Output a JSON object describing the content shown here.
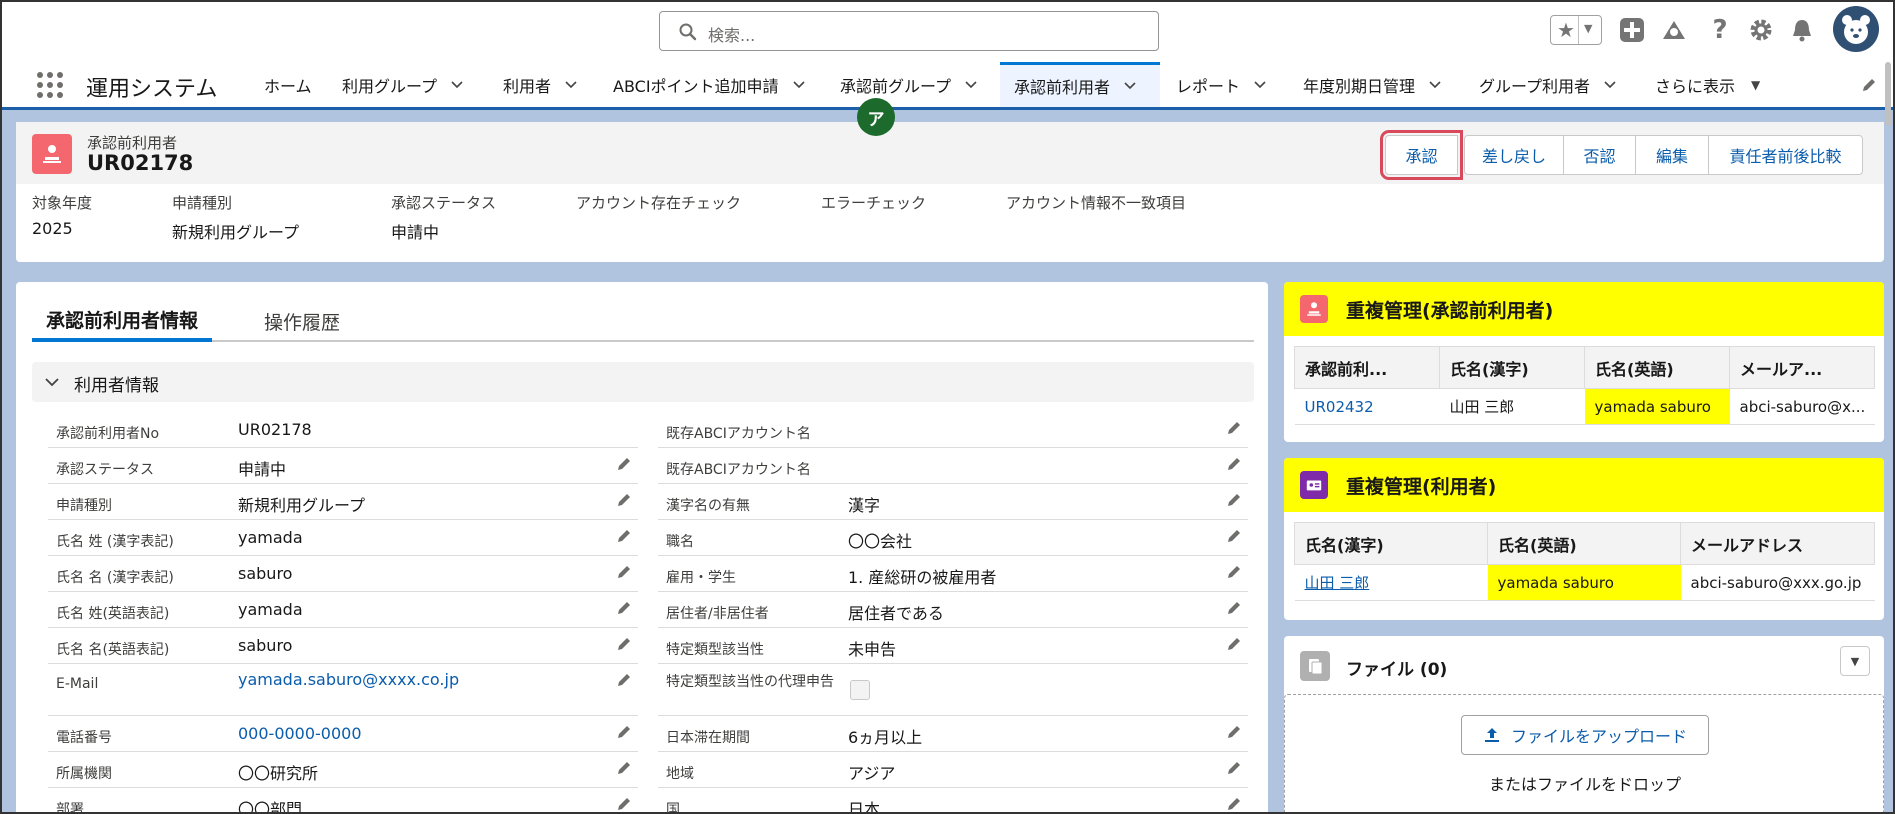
{
  "header": {
    "search_placeholder": "検索...",
    "icons": [
      "star-icon",
      "add-icon",
      "trailhead-icon",
      "help-icon",
      "gear-icon",
      "bell-icon",
      "avatar"
    ]
  },
  "nav": {
    "app_name": "運用システム",
    "items": [
      {
        "label": "ホーム",
        "dropdown": false
      },
      {
        "label": "利用グループ",
        "dropdown": true
      },
      {
        "label": "利用者",
        "dropdown": true
      },
      {
        "label": "ABCIポイント追加申請",
        "dropdown": true
      },
      {
        "label": "承認前グループ",
        "dropdown": true
      },
      {
        "label": "承認前利用者",
        "dropdown": true,
        "active": true
      },
      {
        "label": "レポート",
        "dropdown": true
      },
      {
        "label": "年度別期日管理",
        "dropdown": true
      },
      {
        "label": "グループ利用者",
        "dropdown": true
      },
      {
        "label": "さらに表示",
        "dropdown": true
      }
    ]
  },
  "record": {
    "object_label": "承認前利用者",
    "title": "UR02178",
    "buttons": [
      "承認",
      "差し戻し",
      "否認",
      "編集",
      "責任者前後比較"
    ],
    "highlight_fields": [
      {
        "label": "対象年度",
        "value": "2025"
      },
      {
        "label": "申請種別",
        "value": "新規利用グループ"
      },
      {
        "label": "承認ステータス",
        "value": "申請中"
      },
      {
        "label": "アカウント存在チェック",
        "value": ""
      },
      {
        "label": "エラーチェック",
        "value": "ア"
      },
      {
        "label": "アカウント情報不一致項目",
        "value": ""
      }
    ]
  },
  "detail": {
    "tabs": [
      "承認前利用者情報",
      "操作履歴"
    ],
    "section_title": "利用者情報",
    "left_fields": [
      {
        "label": "承認前利用者No",
        "value": "UR02178",
        "editable": false
      },
      {
        "label": "承認ステータス",
        "value": "申請中",
        "editable": true
      },
      {
        "label": "申請種別",
        "value": "新規利用グループ",
        "editable": true
      },
      {
        "label": "氏名 姓 (漢字表記)",
        "value": "yamada",
        "editable": true
      },
      {
        "label": "氏名 名 (漢字表記)",
        "value": "saburo",
        "editable": true
      },
      {
        "label": "氏名 姓(英語表記)",
        "value": "yamada",
        "editable": true
      },
      {
        "label": "氏名 名(英語表記)",
        "value": "saburo",
        "editable": true
      },
      {
        "label": "E-Mail",
        "value": "yamada.saburo@xxxx.co.jp",
        "editable": true,
        "link": true
      },
      {
        "label": "電話番号",
        "value": "000-0000-0000",
        "editable": true,
        "link": true
      },
      {
        "label": "所属機関",
        "value": "〇〇研究所",
        "editable": true
      },
      {
        "label": "部署",
        "value": "〇〇部門",
        "editable": true
      }
    ],
    "right_fields": [
      {
        "label": "既存ABCIアカウント名",
        "value": "",
        "editable": true
      },
      {
        "label": "既存ABCIアカウント名",
        "value": "",
        "editable": true
      },
      {
        "label": "漢字名の有無",
        "value": "漢字",
        "editable": true
      },
      {
        "label": "職名",
        "value": "〇〇会社",
        "editable": true
      },
      {
        "label": "雇用・学生",
        "value": "1. 産総研の被雇用者",
        "editable": true
      },
      {
        "label": "居住者/非居住者",
        "value": "居住者である",
        "editable": true
      },
      {
        "label": "特定類型該当性",
        "value": "未申告",
        "editable": true
      },
      {
        "label": "特定類型該当性の代理申告",
        "value": "",
        "editable": false,
        "checkbox": true
      },
      {
        "label": "日本滞在期間",
        "value": "6ヵ月以上",
        "editable": true
      },
      {
        "label": "地域",
        "value": "アジア",
        "editable": true
      },
      {
        "label": "国",
        "value": "日本",
        "editable": true
      }
    ]
  },
  "dup_pre": {
    "title": "重複管理(承認前利用者)",
    "columns": [
      "承認前利...",
      "氏名(漢字)",
      "氏名(英語)",
      "メールア..."
    ],
    "row": [
      "UR02432",
      "山田 三郎",
      "yamada saburo",
      "abci-saburo@x..."
    ]
  },
  "dup_user": {
    "title": "重複管理(利用者)",
    "columns": [
      "氏名(漢字)",
      "氏名(英語)",
      "メールアドレス"
    ],
    "row": [
      "山田 三郎",
      "yamada saburo",
      "abci-saburo@xxx.go.jp"
    ]
  },
  "files": {
    "title": "ファイル (0)",
    "upload_label": "ファイルをアップロード",
    "drop_label": "またはファイルをドロップ"
  },
  "colors": {
    "brand": "#0176d3",
    "highlight": "#ffff00",
    "object_icon": "#f4676f",
    "error_badge": "#1c6b2c"
  }
}
